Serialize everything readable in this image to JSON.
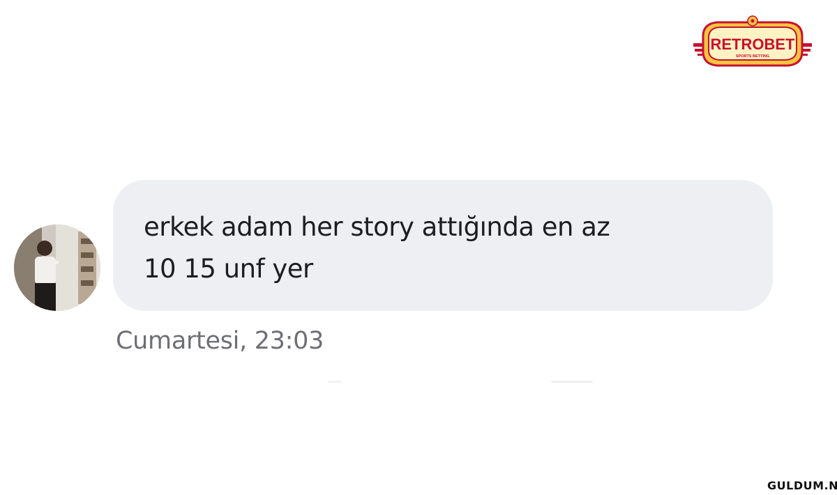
{
  "brand": {
    "name": "RETROBET",
    "tagline": "SPORTS BETTING",
    "colors": {
      "red": "#c8102e",
      "gold": "#f4c542",
      "cream": "#fff3c4"
    }
  },
  "message": {
    "text": "erkek adam her story attığında en az\n10 15 unf yer",
    "timestamp": "Cumartesi, 23:03",
    "bubble_color": "#eeeff2"
  },
  "avatar": {
    "icon": "profile-photo"
  },
  "watermark": {
    "text": "GULDUM.NET"
  }
}
